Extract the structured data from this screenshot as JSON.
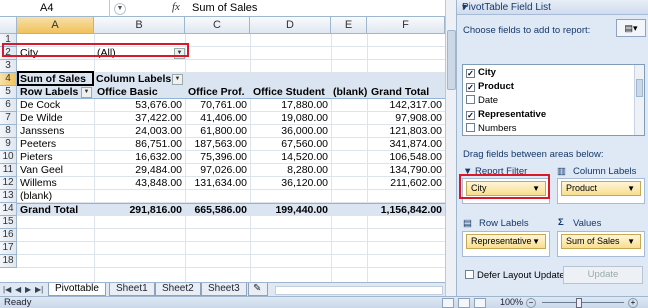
{
  "formula_bar": {
    "name_box": "A4",
    "fx_label": "fx",
    "content": "Sum of Sales"
  },
  "columns": [
    "A",
    "B",
    "C",
    "D",
    "E",
    "F"
  ],
  "rows": [
    "1",
    "2",
    "3",
    "4",
    "5",
    "6",
    "7",
    "8",
    "9",
    "10",
    "11",
    "12",
    "13",
    "14",
    "15",
    "16",
    "17",
    "18"
  ],
  "pivot": {
    "filter_field": "City",
    "filter_value": "(All)",
    "data_caption": "Sum of Sales",
    "column_labels": "Column Labels",
    "row_labels": "Row Labels",
    "headers": [
      "Office Basic",
      "Office Prof.",
      "Office Student",
      "(blank)",
      "Grand Total"
    ],
    "data_rows": [
      {
        "label": "De Cock",
        "values": [
          "53,676.00",
          "70,761.00",
          "17,880.00",
          "",
          "142,317.00"
        ]
      },
      {
        "label": "De Wilde",
        "values": [
          "37,422.00",
          "41,406.00",
          "19,080.00",
          "",
          "97,908.00"
        ]
      },
      {
        "label": "Janssens",
        "values": [
          "24,003.00",
          "61,800.00",
          "36,000.00",
          "",
          "121,803.00"
        ]
      },
      {
        "label": "Peeters",
        "values": [
          "86,751.00",
          "187,563.00",
          "67,560.00",
          "",
          "341,874.00"
        ]
      },
      {
        "label": "Pieters",
        "values": [
          "16,632.00",
          "75,396.00",
          "14,520.00",
          "",
          "106,548.00"
        ]
      },
      {
        "label": "Van Geel",
        "values": [
          "29,484.00",
          "97,026.00",
          "8,280.00",
          "",
          "134,790.00"
        ]
      },
      {
        "label": "Willems",
        "values": [
          "43,848.00",
          "131,634.00",
          "36,120.00",
          "",
          "211,602.00"
        ]
      },
      {
        "label": "(blank)",
        "values": [
          "",
          "",
          "",
          "",
          ""
        ]
      }
    ],
    "grand_total": {
      "label": "Grand Total",
      "values": [
        "291,816.00",
        "665,586.00",
        "199,440.00",
        "",
        "1,156,842.00"
      ]
    }
  },
  "sheet_tabs": [
    "Pivottable",
    "Sheet1",
    "Sheet2",
    "Sheet3"
  ],
  "status": {
    "text": "Ready",
    "zoom": "100%"
  },
  "panel": {
    "title": "PivotTable Field List",
    "choose_label": "Choose fields to add to report:",
    "fields": [
      {
        "name": "City",
        "checked": "✓"
      },
      {
        "name": "Product",
        "checked": "✓"
      },
      {
        "name": "Date",
        "checked": ""
      },
      {
        "name": "Representative",
        "checked": "✓"
      },
      {
        "name": "Numbers",
        "checked": ""
      }
    ],
    "drag_label": "Drag fields between areas below:",
    "report_filter_label": "Report Filter",
    "column_labels_label": "Column Labels",
    "row_labels_label": "Row Labels",
    "values_label": "Values",
    "report_filter_chip": "City",
    "column_labels_chip": "Product",
    "row_labels_chip": "Representative",
    "values_chip": "Sum of Sales",
    "defer_label": "Defer Layout Update",
    "update_button": "Update"
  }
}
